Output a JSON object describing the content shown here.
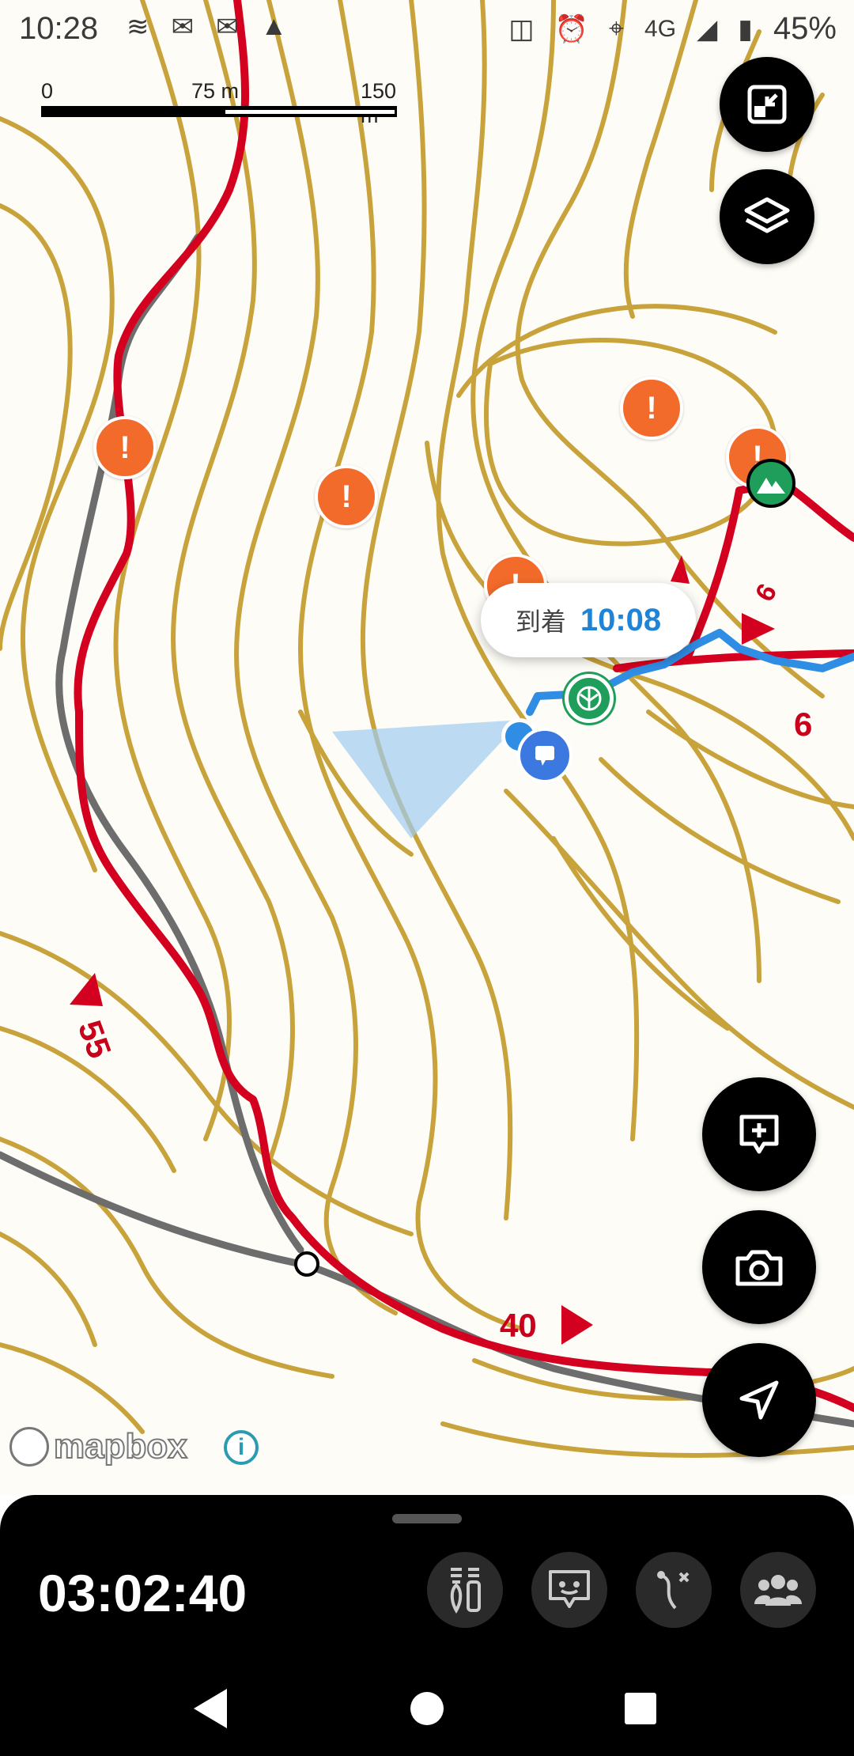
{
  "status_bar": {
    "time": "10:28",
    "network": "4G",
    "battery": "45%",
    "left_icons": [
      "weather-icon",
      "mail-icon",
      "mail-icon",
      "triangle-app-icon"
    ],
    "right_icons": [
      "nfc-icon",
      "alarm-icon",
      "location-icon",
      "signal-icon",
      "battery-icon"
    ]
  },
  "scale_bar": {
    "label_0": "0",
    "label_mid": "75 m",
    "label_end": "150 m"
  },
  "map": {
    "arrival_label": "到着",
    "arrival_time": "10:08",
    "route_numbers": [
      "6",
      "6",
      "55",
      "40"
    ],
    "attribution": "mapbox",
    "info": "i",
    "colors": {
      "contour": "#c8a23a",
      "route_red": "#d3001f",
      "track_blue": "#2f8de4",
      "hazard": "#f36b2a",
      "path_gray": "#6d6d6d"
    }
  },
  "buttons": [
    "exit-fullscreen-icon",
    "layers-icon",
    "add-comment-icon",
    "camera-icon",
    "navigate-icon"
  ],
  "bottom_sheet": {
    "elapsed_time": "03:02:40",
    "actions": [
      "gear-pack-icon",
      "memo-icon",
      "route-off-icon",
      "group-icon"
    ]
  },
  "nav_bar": [
    "back-icon",
    "home-icon",
    "recents-icon"
  ]
}
